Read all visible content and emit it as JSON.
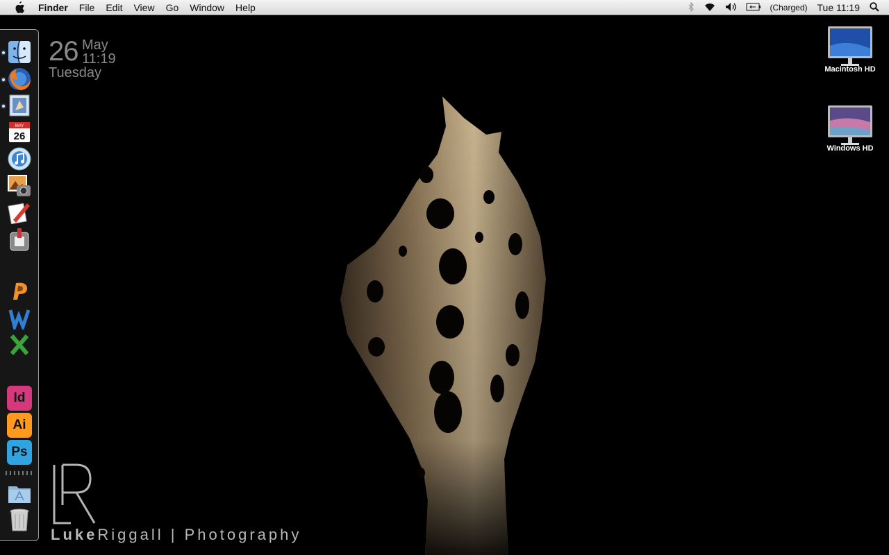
{
  "menubar": {
    "app_name": "Finder",
    "items": [
      "File",
      "Edit",
      "View",
      "Go",
      "Window",
      "Help"
    ],
    "status": {
      "battery_text": "(Charged)",
      "clock": "Tue 11:19"
    },
    "icons": [
      "apple-icon",
      "bluetooth-icon",
      "wifi-icon",
      "volume-icon",
      "battery-icon",
      "spotlight-icon"
    ]
  },
  "clock_widget": {
    "day": "26",
    "month": "May",
    "time": "11:19",
    "weekday": "Tuesday"
  },
  "dock": {
    "calendar_month": "MAY",
    "calendar_day": "26",
    "adobe": [
      {
        "label": "Id",
        "color": "#d6387d"
      },
      {
        "label": "Ai",
        "color": "#ff9a1e"
      },
      {
        "label": "Ps",
        "color": "#2fa4e0"
      }
    ],
    "items": [
      "finder",
      "firefox",
      "mail",
      "ical",
      "itunes",
      "iphoto",
      "textedit",
      "sysprefs",
      "powerpoint",
      "word",
      "excel",
      "indesign",
      "illustrator",
      "photoshop",
      "applications",
      "trash"
    ]
  },
  "desktop": {
    "drives": [
      {
        "label": "Macintosh HD"
      },
      {
        "label": "Windows HD"
      }
    ]
  },
  "branding": {
    "first": "Luke",
    "last": "Riggall",
    "separator": "|",
    "suffix": "Photography"
  }
}
